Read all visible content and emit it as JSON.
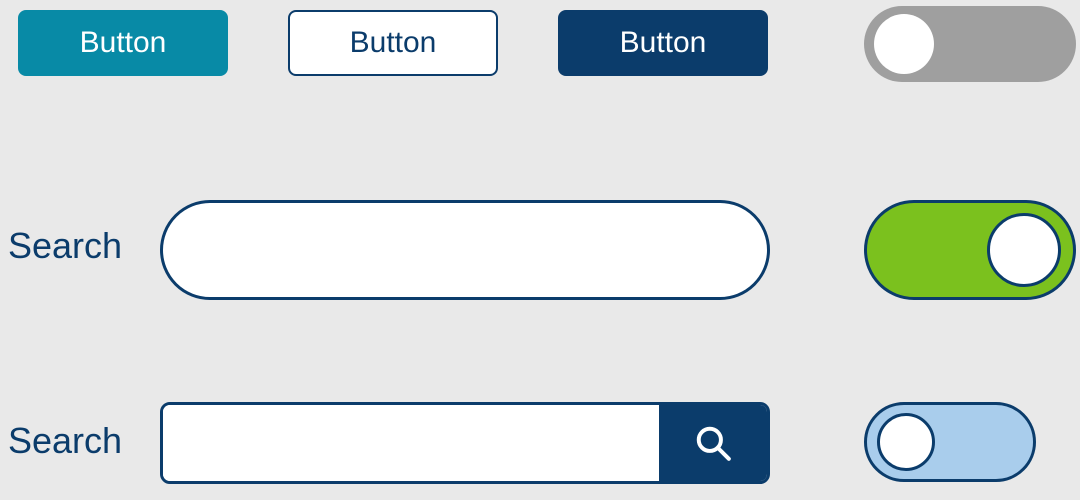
{
  "buttons": {
    "teal": {
      "label": "Button"
    },
    "outline": {
      "label": "Button"
    },
    "navy": {
      "label": "Button"
    }
  },
  "search": {
    "pill": {
      "label": "Search",
      "value": ""
    },
    "rect": {
      "label": "Search",
      "value": ""
    },
    "submit_icon": "search-icon"
  },
  "toggles": {
    "grey": {
      "on": false,
      "track_color": "#9f9f9f"
    },
    "green": {
      "on": true,
      "track_color": "#7bc11e",
      "border_color": "#0b3c6b"
    },
    "lightblue": {
      "on": false,
      "track_color": "#a9cdec",
      "border_color": "#0b3c6b"
    }
  },
  "colors": {
    "navy": "#0b3c6b",
    "teal": "#088aa6",
    "green": "#7bc11e",
    "lightblue": "#a9cdec",
    "grey": "#9f9f9f"
  }
}
